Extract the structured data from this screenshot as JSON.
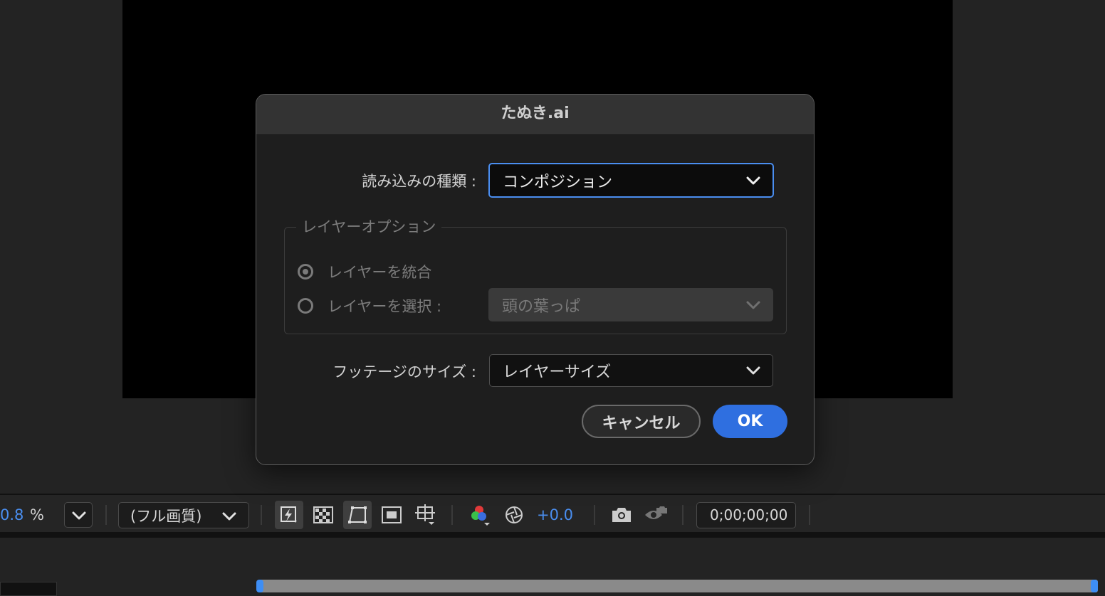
{
  "dialog": {
    "title": "たぬき.ai",
    "import_kind_label": "読み込みの種類 :",
    "import_kind_value": "コンポジション",
    "layer_options_legend": "レイヤーオプション",
    "radio_merge_label": "レイヤーを統合",
    "radio_merge_selected": true,
    "radio_choose_label": "レイヤーを選択 :",
    "radio_choose_selected": false,
    "layer_select_value": "頭の葉っぱ",
    "footage_size_label": "フッテージのサイズ :",
    "footage_size_value": "レイヤーサイズ",
    "cancel_label": "キャンセル",
    "ok_label": "OK",
    "accent_color": "#2f6fe0"
  },
  "toolbar": {
    "zoom_value": "0.8",
    "zoom_unit": "%",
    "resolution_value": "(フル画質)",
    "exposure_value": "+0.0",
    "timecode_value": "0;00;00;00",
    "icons": [
      "zoom-dropdown-icon",
      "fast-preview-icon",
      "transparency-grid-icon",
      "mask-path-icon",
      "region-of-interest-icon",
      "safe-margins-icon",
      "color-channels-icon",
      "reset-exposure-icon",
      "snapshot-icon",
      "show-snapshot-icon"
    ]
  }
}
